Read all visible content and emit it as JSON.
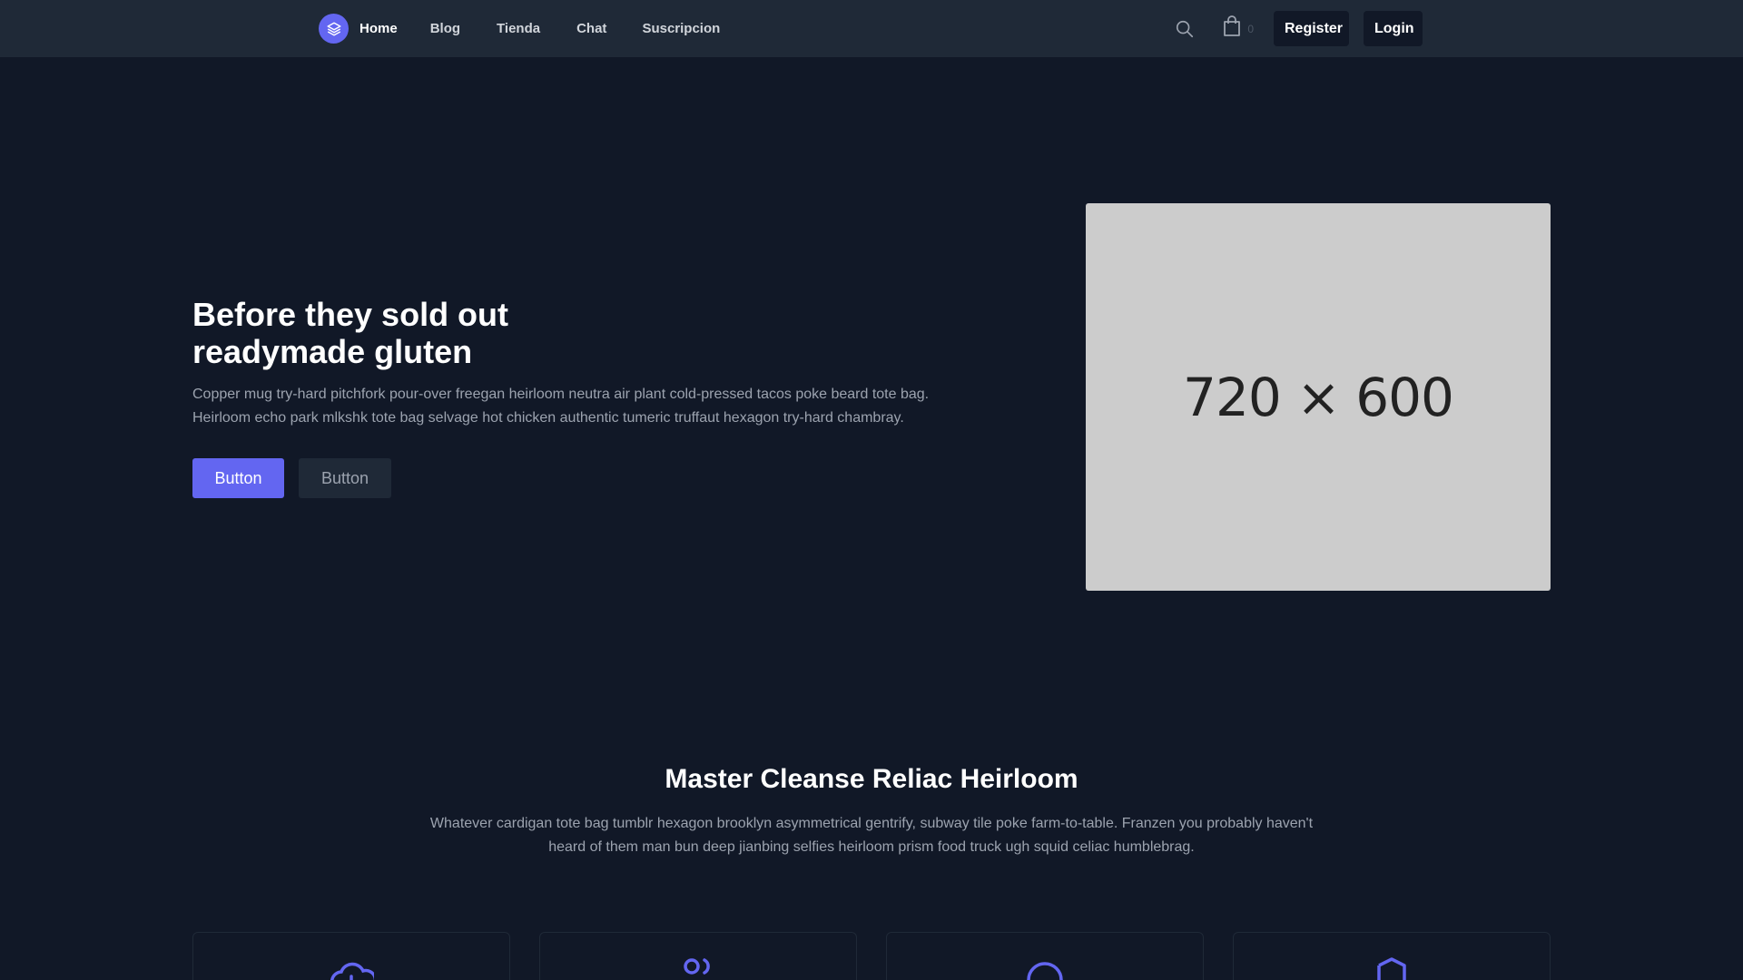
{
  "colors": {
    "background": "#111827",
    "navbar": "#1f2937",
    "accent": "#6366f1",
    "placeholder": "#cccccc"
  },
  "navbar": {
    "logo_icon": "layers-icon",
    "links": [
      {
        "label": "Home",
        "active": true
      },
      {
        "label": "Blog"
      },
      {
        "label": "Tienda"
      },
      {
        "label": "Chat"
      },
      {
        "label": "Suscripcion"
      }
    ],
    "search_icon": "search-icon",
    "cart_icon": "shopping-bag-icon",
    "cart_count": "0",
    "register_label": "Register",
    "login_label": "Login"
  },
  "hero": {
    "title_line1": "Before they sold out",
    "title_line2": "readymade gluten",
    "description": "Copper mug try-hard pitchfork pour-over freegan heirloom neutra air plant cold-pressed tacos poke beard tote bag. Heirloom echo park mlkshk tote bag selvage hot chicken authentic tumeric truffaut hexagon try-hard chambray.",
    "primary_button": "Button",
    "secondary_button": "Button",
    "image_placeholder": "720 × 600"
  },
  "features": {
    "title": "Master Cleanse Reliac Heirloom",
    "description": "Whatever cardigan tote bag tumblr hexagon brooklyn asymmetrical gentrify, subway tile poke farm-to-table. Franzen you probably haven't heard of them man bun deep jianbing selfies heirloom prism food truck ugh squid celiac humblebrag.",
    "cards": [
      {
        "icon": "cloud-download-icon"
      },
      {
        "icon": "users-icon"
      },
      {
        "icon": "circle-icon"
      },
      {
        "icon": "shield-icon"
      }
    ]
  }
}
